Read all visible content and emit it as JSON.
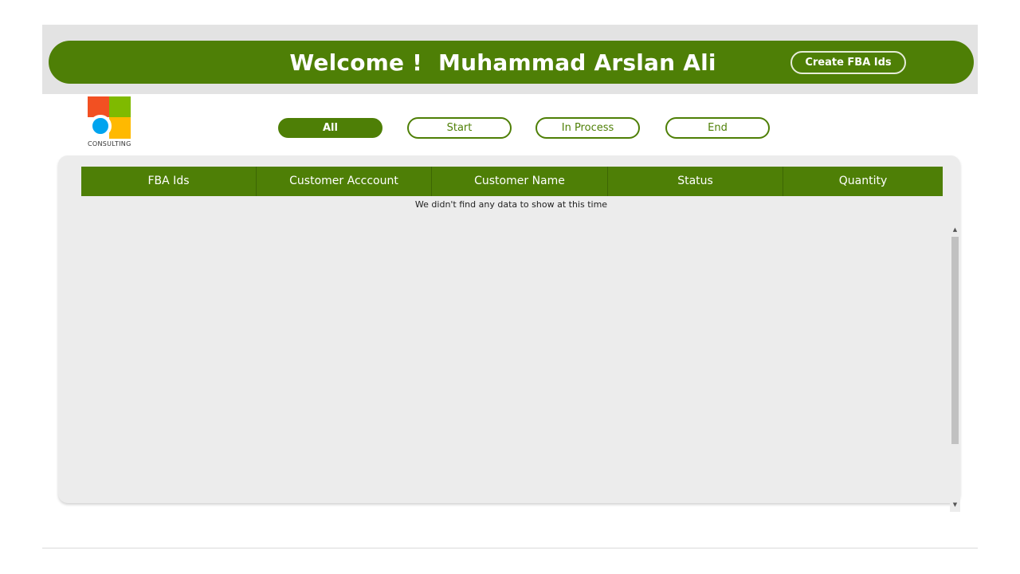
{
  "header": {
    "welcome_text": "Welcome !  Muhammad Arslan Ali",
    "create_button_label": "Create FBA Ids"
  },
  "logo": {
    "text": "CONSULTING"
  },
  "filters": [
    {
      "label": "All",
      "active": true
    },
    {
      "label": "Start",
      "active": false
    },
    {
      "label": "In Process",
      "active": false
    },
    {
      "label": "End",
      "active": false
    }
  ],
  "table": {
    "columns": [
      "FBA Ids",
      "Customer Acccount",
      "Customer Name",
      "Status",
      "Quantity"
    ],
    "rows": [],
    "empty_message": "We didn't find any data to show at this time"
  },
  "colors": {
    "primary_green": "#4e7f06",
    "panel_bg": "#ececec"
  }
}
